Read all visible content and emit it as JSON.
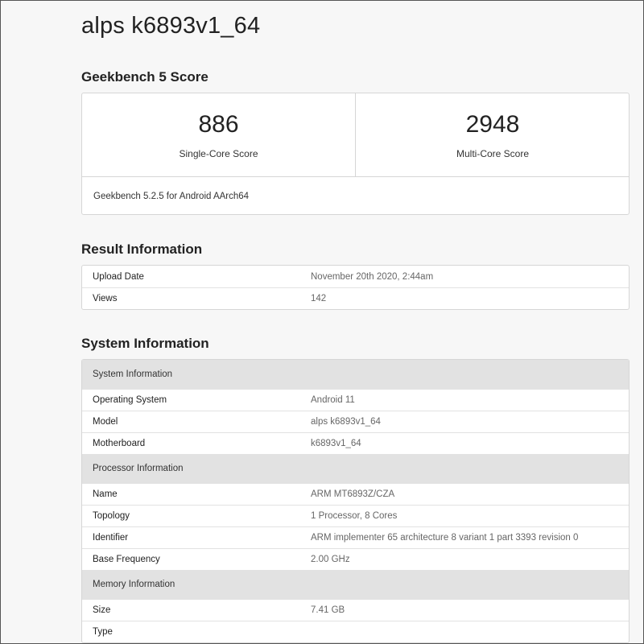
{
  "title": "alps k6893v1_64",
  "geekbench": {
    "heading": "Geekbench 5 Score",
    "single_score": "886",
    "single_label": "Single-Core Score",
    "multi_score": "2948",
    "multi_label": "Multi-Core Score",
    "version": "Geekbench 5.2.5 for Android AArch64"
  },
  "result": {
    "heading": "Result Information",
    "rows": [
      {
        "label": "Upload Date",
        "value": "November 20th 2020, 2:44am"
      },
      {
        "label": "Views",
        "value": "142"
      }
    ]
  },
  "system": {
    "heading": "System Information",
    "sections": [
      {
        "header": "System Information",
        "rows": [
          {
            "label": "Operating System",
            "value": "Android 11"
          },
          {
            "label": "Model",
            "value": "alps k6893v1_64"
          },
          {
            "label": "Motherboard",
            "value": "k6893v1_64"
          }
        ]
      },
      {
        "header": "Processor Information",
        "rows": [
          {
            "label": "Name",
            "value": "ARM MT6893Z/CZA"
          },
          {
            "label": "Topology",
            "value": "1 Processor, 8 Cores"
          },
          {
            "label": "Identifier",
            "value": "ARM implementer 65 architecture 8 variant 1 part 3393 revision 0"
          },
          {
            "label": "Base Frequency",
            "value": "2.00 GHz"
          }
        ]
      },
      {
        "header": "Memory Information",
        "rows": [
          {
            "label": "Size",
            "value": "7.41 GB"
          },
          {
            "label": "Type",
            "value": ""
          }
        ]
      }
    ]
  }
}
